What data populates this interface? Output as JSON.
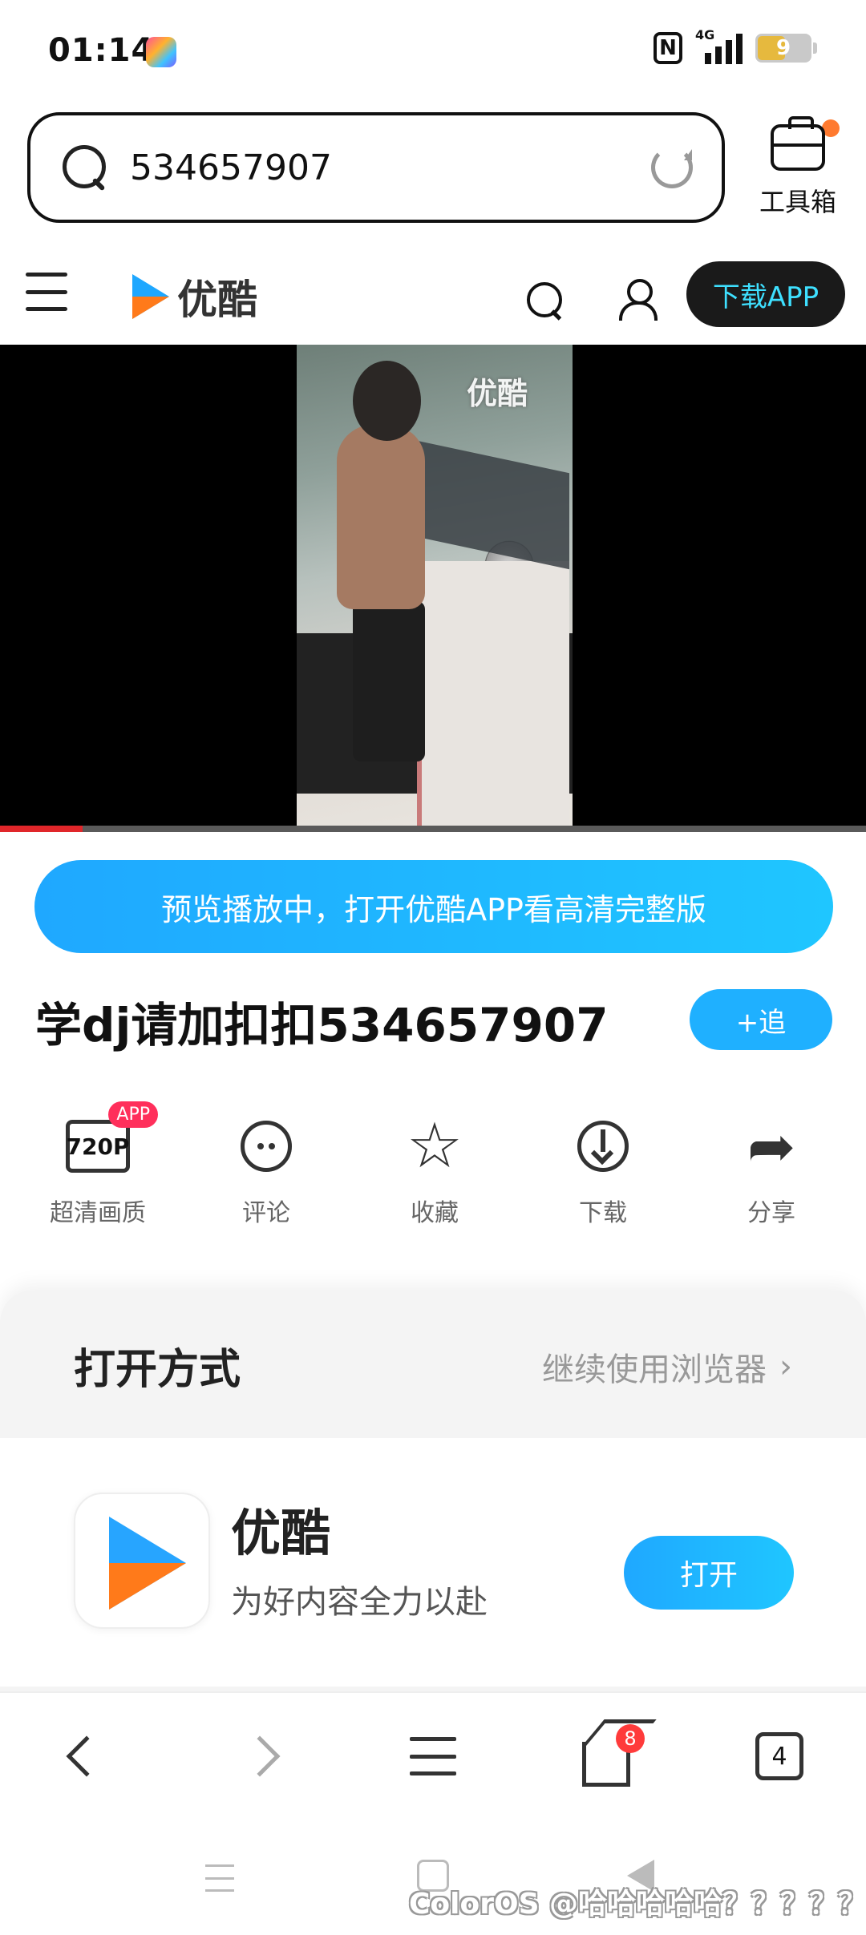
{
  "status": {
    "time": "01:14",
    "network": "4G",
    "battery": "9"
  },
  "browser": {
    "query": "534657907",
    "toolbox_label": "工具箱"
  },
  "header": {
    "logo": "优酷",
    "download_label": "下载APP"
  },
  "video": {
    "watermark": "优酷",
    "progress": 0.095
  },
  "banner": "预览播放中，打开优酷APP看高清完整版",
  "title": "学dj请加扣扣534657907",
  "follow_label": "+追",
  "actions": [
    {
      "icon": "hd-quality-icon",
      "label": "超清画质",
      "quality": "720P",
      "badge": "APP"
    },
    {
      "icon": "comment-icon",
      "label": "评论"
    },
    {
      "icon": "star-icon",
      "label": "收藏"
    },
    {
      "icon": "download-icon",
      "label": "下载"
    },
    {
      "icon": "share-icon",
      "label": "分享"
    }
  ],
  "open_sheet": {
    "title": "打开方式",
    "continue_label": "继续使用浏览器",
    "app_name": "优酷",
    "app_slogan": "为好内容全力以赴",
    "open_label": "打开"
  },
  "bottom_nav": {
    "home_badge": "8",
    "tab_count": "4"
  },
  "watermark": "ColorOS @哈哈哈哈哈？？？？？"
}
